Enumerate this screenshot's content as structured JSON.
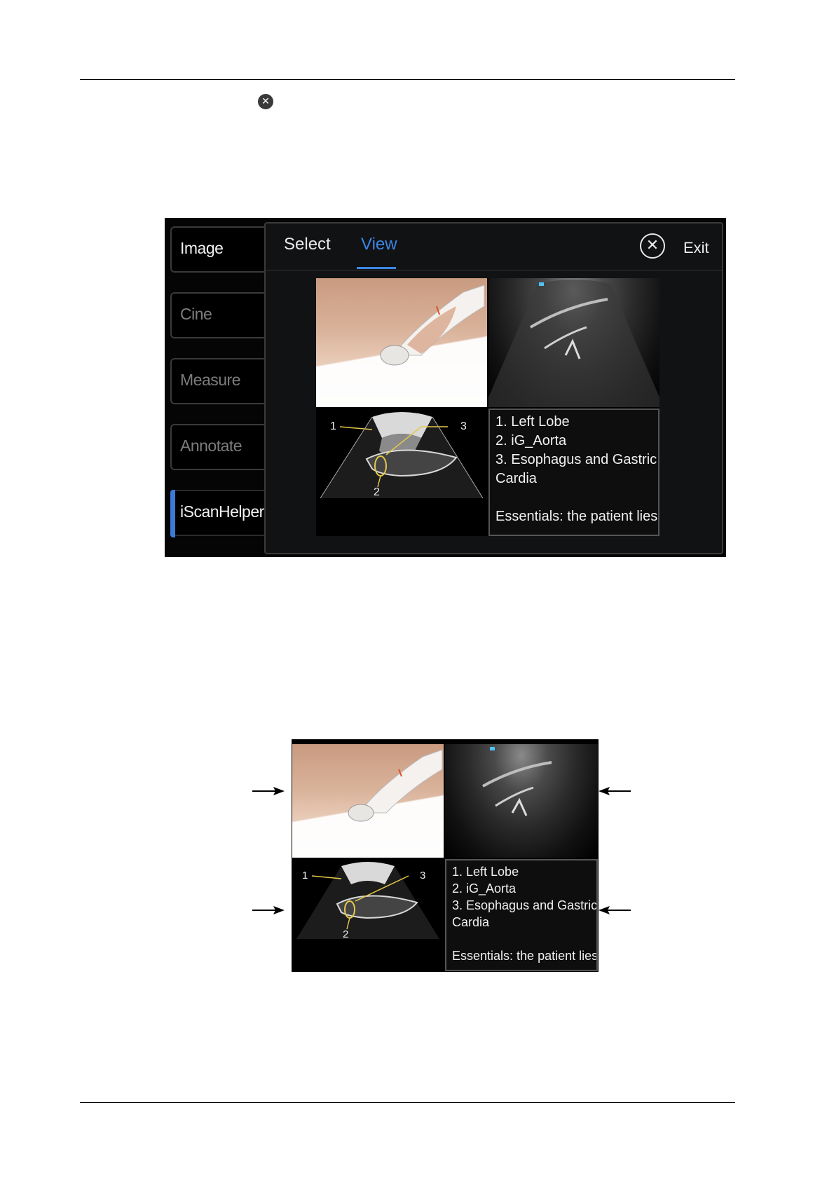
{
  "panel": {
    "tabs": [
      {
        "label": "Image"
      },
      {
        "label": "Cine"
      },
      {
        "label": "Measure"
      },
      {
        "label": "Annotate"
      },
      {
        "label": "iScanHelper"
      }
    ],
    "top_tabs": {
      "select": "Select",
      "view": "View"
    },
    "exit_label": "Exit"
  },
  "figure": {
    "diagram_labels": [
      "1",
      "2",
      "3"
    ],
    "legend_lines": [
      "1. Left Lobe",
      "2. iG_Aorta",
      "3. Esophagus and Gastric",
      "Cardia"
    ],
    "essentials": "Essentials: the patient lies"
  },
  "colors": {
    "accent": "#3b86e6",
    "panel_bg": "#111214",
    "legend_border": "#555555"
  }
}
